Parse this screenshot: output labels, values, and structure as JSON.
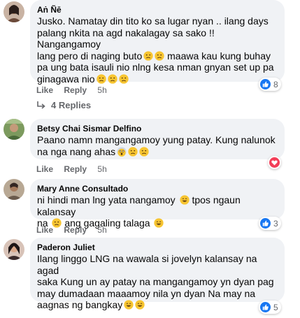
{
  "comments": [
    {
      "author": "Aṅ Ñē",
      "text_lines": [
        "Jusko. Namatay din tito ko sa lugar nyan .. ilang days",
        "palang nkita na agd nakalagay sa sako !! Nangangamoy",
        "lang pero di naging buto",
        "maawa kau kung buhay",
        "pa ung bata isauli nio nlng kesa nman gnyan set up pa",
        "ginagawa nio"
      ],
      "like_label": "Like",
      "reply_label": "Reply",
      "time": "5h",
      "reaction_count": "8",
      "reaction_type": "like"
    },
    {
      "author": "Betsy Chai Sismar Delfino",
      "text_lines": [
        "Paano namn mangangamoy yung patay. Kung nalunok",
        "na nga nang ahas"
      ],
      "like_label": "Like",
      "reply_label": "Reply",
      "time": "5h",
      "reaction_count": "",
      "reaction_type": "love"
    },
    {
      "author": "Mary Anne Consultado",
      "text_lines": [
        "ni hindi man lng yata nangamoy",
        "tpos ngaun kalansay",
        "na",
        "ang gagaling talaga"
      ],
      "like_label": "Like",
      "reply_label": "Reply",
      "time": "5h",
      "reaction_count": "3",
      "reaction_type": "like"
    },
    {
      "author": "Paderon Juliet",
      "text_lines": [
        "Ilang linggo LNG na wawala si jovelyn kalansay na agad",
        "saka Kung un ay patay na mangangamoy yn dyan pag",
        "may dumadaan maaamoy nila yn dyan Na may na",
        "aagnas ng bangkay"
      ],
      "like_label": "Like",
      "reply_label": "Reply",
      "time": "5h",
      "reaction_count": "5",
      "reaction_type": "like"
    }
  ],
  "replies_label": "4 Replies",
  "colors": {
    "bubble": "#f0f2f5",
    "meta": "#65676b",
    "like_blue": "#1877f2",
    "love_red": "#f33e58",
    "emoji_yellow": "#f7c531"
  },
  "emoji_names": [
    "sad-face-icon",
    "screaming-face-icon",
    "grinning-face-icon",
    "disappointed-face-icon"
  ]
}
